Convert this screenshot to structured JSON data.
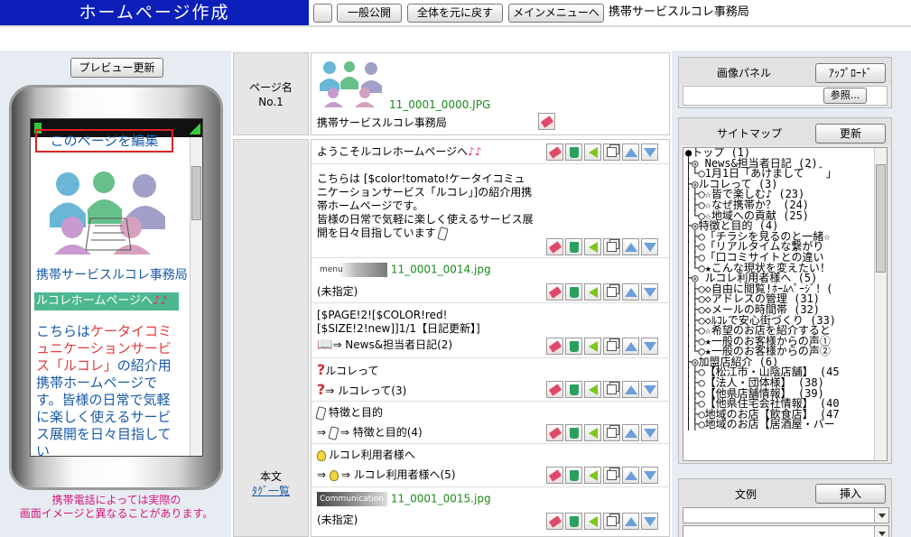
{
  "header": {
    "title": "ホームページ作成",
    "buttons": [
      "",
      "一般公開",
      "全体を元に戻す",
      "メインメニューへ"
    ],
    "site_name": "携帯サービスルコレ事務局"
  },
  "preview": {
    "update_button": "プレビュー更新",
    "edit_link": "このページを編集",
    "site_name": "携帯サービスルコレ事務局",
    "bar_text": "ルコレホームページへ",
    "body_red": "ケータイコミュニケーションサービス「ルコレ」",
    "body_pre": "こちらは",
    "body_post": "の紹介用携帯ホームページです。皆様の日常で気軽に楽しく使えるサービス展開を日々目指してい",
    "note_line1": "携帯電話によっては実際の",
    "note_line2": "画面イメージと異なることがあります。"
  },
  "page_name_label": {
    "line1": "ページ名",
    "line2": "No.1"
  },
  "body_label": {
    "line1": "本文",
    "link": "ﾀｸﾞ一覧"
  },
  "page_name": {
    "image_file": "11_0001_0000.JPG",
    "name": "携帯サービスルコレ事務局"
  },
  "rows": [
    {
      "text": "ようこそルコレホームページへ"
    },
    {
      "text": "こちらは [$color!tomato!ケータイコミュニケーションサービス「ルコレ」]の紹介用携帯ホームページです。\n皆様の日常で気軽に楽しく使えるサービス展開を日々目指しています"
    },
    {
      "file": "11_0001_0014.jpg",
      "img_label": "menu",
      "text": "(未指定)"
    },
    {
      "text": "[$PAGE!2![$COLOR!red![$SIZE!2!new]]1/1【日記更新】]",
      "sub": "⇒ News&担当者日記(2)"
    },
    {
      "text": "ルコレって",
      "sub": "⇒ ルコレって(3)"
    },
    {
      "text": "特徴と目的",
      "sub": "⇒ 特徴と目的(4)"
    },
    {
      "text": "ルコレ利用者様へ",
      "sub": "⇒ ルコレ利用者様へ(5)"
    },
    {
      "file": "11_0001_0015.jpg",
      "img_label": "Communication",
      "text": "(未指定)"
    }
  ],
  "image_panel": {
    "label": "画像パネル",
    "upload": "ｱｯﾌﾟﾛｰﾄﾞ",
    "browse": "参照..."
  },
  "sitemap": {
    "label": "サイトマップ",
    "update": "更新",
    "lines": [
      "●トップ (1)",
      "├◎ News&担当者日記 (2)",
      "│└○1月1日「あけまして＾＾」",
      "├◎ルコレって (3)",
      "│├○☆皆で楽しむ♪ (23)",
      "│├○☆なぜ携帯か？ (24)",
      "│└○☆地域への貢献 (25)",
      "├◎特徴と目的 (4)",
      "│├○「チラシを見るのと一緒☆",
      "│├○「リアルタイムな繋がり",
      "│├○「口コミサイトとの違い",
      "│└○★こんな現状を変えたい！",
      "├◎ ルコレ利用者様へ (5)",
      "│├○◇自由に閲覧!ﾎｰﾑﾍﾟｰｼﾞ！(",
      "│├○◇アドレスの管理 (31)",
      "│├○◇メールの時間帯 (32)",
      "│├○◇ﾙｺﾚで安心街づくり (33)",
      "│├○☆希望のお店を紹介すると",
      "│├○★一般のお客様からの声①",
      "│└○★一般のお客様からの声②",
      "├◎加盟店紹介 (6)",
      "│├○【松江市・山陰店舗】 (45",
      "│├○【法人・団体様】 (38)",
      "│├○【他県店舗情報】 (39)",
      "│├○【他県住宅会社情報】 (40",
      "│├○地域のお店【飲食店】 (47",
      "│├○地域のお店【居酒屋・バー"
    ]
  },
  "bunrei": {
    "label": "文例",
    "insert": "挿入"
  },
  "colors": {
    "title_bg": "#0c1fb8",
    "band": "#e7ecf2",
    "green_text": "#1a8a1a",
    "link_blue": "#1a5aa8",
    "note_pink": "#d6157e"
  }
}
